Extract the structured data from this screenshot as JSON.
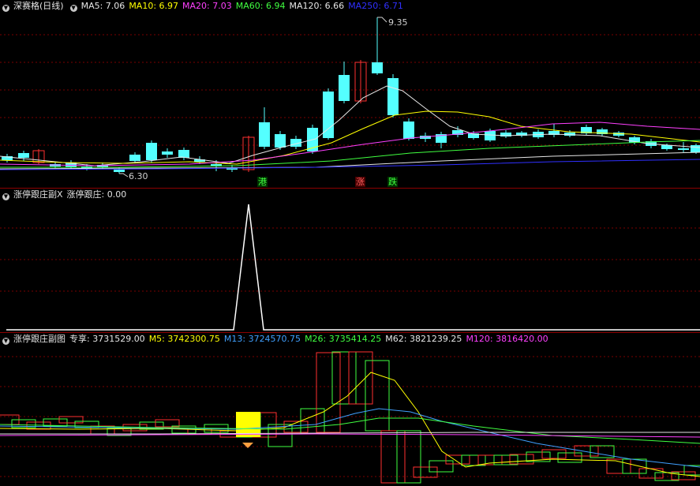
{
  "top": {
    "stock_name": "深赛格(日线)",
    "indicators": [
      {
        "label": "MA5: 7.06",
        "color": "#e6e6e6"
      },
      {
        "label": "MA10: 6.97",
        "color": "#ffff00"
      },
      {
        "label": "MA20: 7.03",
        "color": "#ff40ff"
      },
      {
        "label": "MA60: 6.94",
        "color": "#40ff40"
      },
      {
        "label": "MA120: 6.66",
        "color": "#e6e6e6"
      },
      {
        "label": "MA250: 6.71",
        "color": "#3030ff"
      }
    ],
    "high_label": "9.35",
    "low_label": "6.30",
    "tags": [
      {
        "text": "港",
        "color": "#40ff40",
        "bg": "#003300"
      },
      {
        "text": "涨",
        "color": "#ff6060",
        "bg": "#4a0000"
      },
      {
        "text": "跌",
        "color": "#40ff40",
        "bg": "#003300"
      }
    ]
  },
  "middle": {
    "title": "涨停跟庄副X",
    "value_label": "涨停跟庄: 0.00"
  },
  "bottom": {
    "title": "涨停跟庄副图",
    "indicators": [
      {
        "label": "专享: 3731529.00",
        "color": "#e6e6e6"
      },
      {
        "label": "M5: 3742300.75",
        "color": "#ffff00"
      },
      {
        "label": "M13: 3724570.75",
        "color": "#40a0ff"
      },
      {
        "label": "M26: 3735414.25",
        "color": "#40ff40"
      },
      {
        "label": "M62: 3821239.25",
        "color": "#e6e6e6"
      },
      {
        "label": "M120: 3816420.00",
        "color": "#ff40ff"
      }
    ]
  },
  "colors": {
    "up": "#ff3030",
    "down": "#54ffff",
    "grid": "#7a0000",
    "signal": "#ffff00"
  }
}
